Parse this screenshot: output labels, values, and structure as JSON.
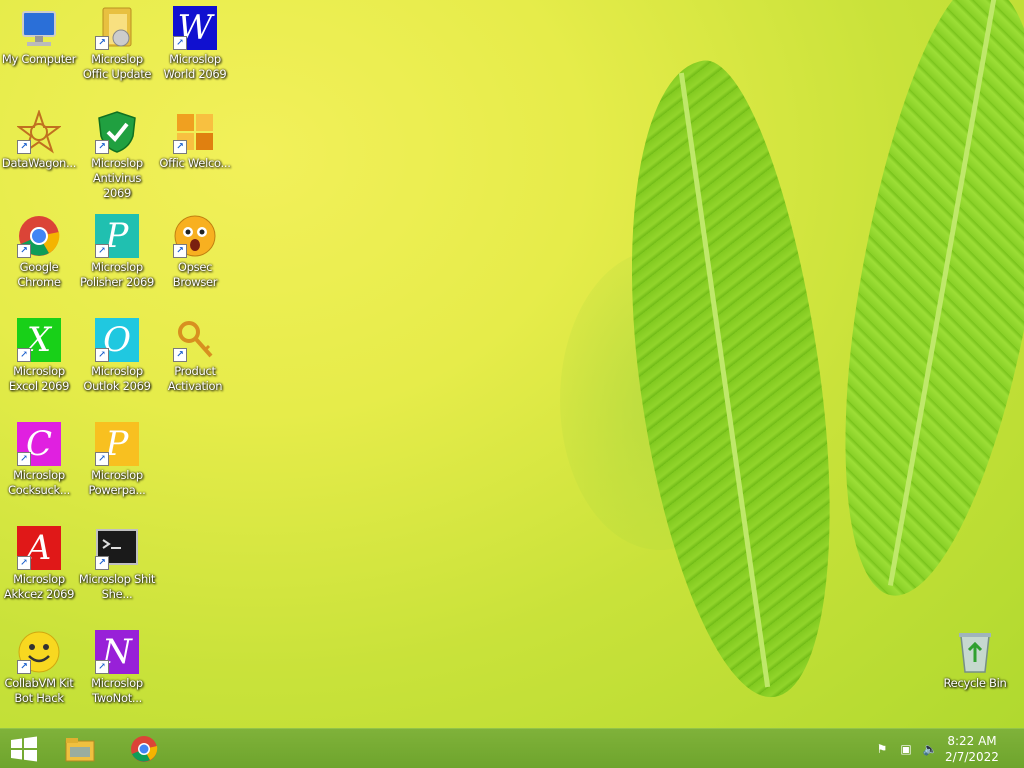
{
  "desktop": {
    "icons": [
      {
        "label": "My Computer",
        "icon": "computer-icon"
      },
      {
        "label": "Microslop Offic Update",
        "icon": "folder-update-icon"
      },
      {
        "label": "Microslop World 2069",
        "icon": "word-icon"
      },
      {
        "label": "DataWagon...",
        "icon": "datawagon-icon"
      },
      {
        "label": "Microslop Antivirus 2069",
        "icon": "shield-icon"
      },
      {
        "label": "Offic Welco...",
        "icon": "office-icon"
      },
      {
        "label": "Google Chrome",
        "icon": "chrome-icon"
      },
      {
        "label": "Microslop Polisher 2069",
        "icon": "polisher-icon"
      },
      {
        "label": "Opsec Browser",
        "icon": "opsec-browser-icon"
      },
      {
        "label": "Microslop Excol 2069",
        "icon": "excel-icon"
      },
      {
        "label": "Microslop Outlok 2069",
        "icon": "outlook-icon"
      },
      {
        "label": "Product Activation",
        "icon": "key-icon"
      },
      {
        "label": "Microslop Cocksuck...",
        "icon": "c-tile-icon"
      },
      {
        "label": "Microslop Powerpa...",
        "icon": "powerpoint-icon"
      },
      {
        "label": "Microslop Akkcez 2069",
        "icon": "access-icon"
      },
      {
        "label": "Microslop Shit She...",
        "icon": "terminal-icon"
      },
      {
        "label": "CollabVM Kit Bot Hack",
        "icon": "smiley-icon"
      },
      {
        "label": "Microslop TwoNot...",
        "icon": "onenote-icon"
      },
      {
        "label": "Recycle Bin",
        "icon": "recycle-bin-icon"
      }
    ]
  },
  "taskbar": {
    "clock_time": "8:22 AM",
    "clock_date": "2/7/2022"
  },
  "colors": {
    "word": "#1010d0",
    "polisher": "#20c0b0",
    "excel": "#18d018",
    "outlook": "#20c8e0",
    "c_tile": "#e020e0",
    "powerpoint": "#f8c020",
    "access": "#e01818",
    "onenote": "#9820d8"
  }
}
